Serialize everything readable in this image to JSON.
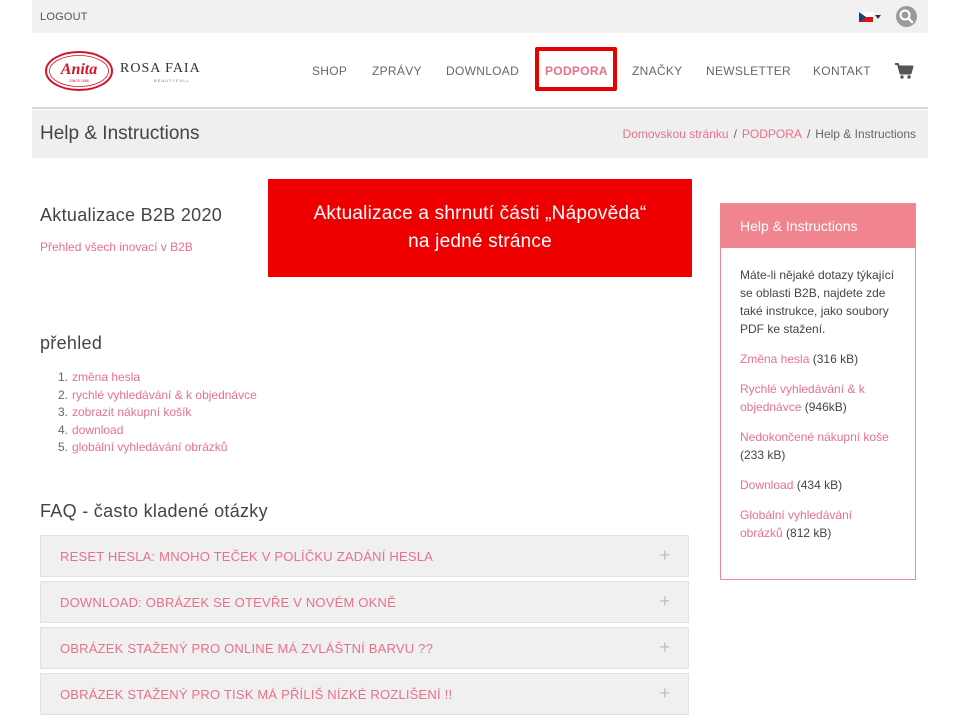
{
  "topbar": {
    "logout_label": "LOGOUT",
    "language": "CZ",
    "search_icon": "search-icon"
  },
  "header": {
    "logo_text": "Anita",
    "logo_since": "SINCE 1886",
    "brand_name": "ROSA FAIA",
    "brand_tagline": "BEAUTYFULL",
    "nav": [
      "SHOP",
      "ZPRÁVY",
      "DOWNLOAD",
      "PODPORA",
      "ZNAČKY",
      "NEWSLETTER",
      "KONTAKT"
    ],
    "active_nav": "PODPORA",
    "cart_icon": "shopping-cart-icon"
  },
  "title_band": {
    "page_title": "Help & Instructions",
    "breadcrumb": [
      "Domovskou stránku",
      "PODPORA",
      "Help & Instructions"
    ],
    "separator": "/"
  },
  "main": {
    "update_heading": "Aktualizace B2B 2020",
    "update_link": "Přehled všech inovací v B2B",
    "overview_heading": "přehled",
    "overview_items": [
      {
        "num": "1.",
        "label": "změna hesla"
      },
      {
        "num": "2.",
        "label": "rychlé vyhledávání & k objednávce"
      },
      {
        "num": "3.",
        "label": "zobrazit nákupní košík"
      },
      {
        "num": "4.",
        "label": "download"
      },
      {
        "num": "5.",
        "label": "globální vyhledávání obrázků"
      }
    ],
    "faq_heading": "FAQ - často kladené otázky",
    "faq_items": [
      "RESET HESLA: MNOHO TEČEK V POLÍČKU ZADÁNÍ HESLA",
      "DOWNLOAD: OBRÁZEK SE OTEVŘE V NOVÉM OKNĚ",
      "OBRÁZEK STAŽENÝ PRO ONLINE MÁ ZVLÁŠTNÍ BARVU ??",
      "OBRÁZEK STAŽENÝ PRO TISK MÁ PŘÍLIŠ NÍZKÉ ROZLIŠENÍ !!"
    ],
    "faq_expand_symbol": "+"
  },
  "callout": {
    "line1": "Aktualizace a shrnutí části „Nápověda“",
    "line2": "na jedné stránce"
  },
  "sidebar": {
    "title": "Help & Instructions",
    "intro": "Máte-li nějaké dotazy týkající se oblasti B2B, najdete zde také instrukce, jako soubory PDF ke stažení.",
    "files": [
      {
        "label": "Změna hesla",
        "size": "(316 kB)"
      },
      {
        "label": "Rychlé vyhledávání & k objednávce",
        "size": "(946kB)"
      },
      {
        "label": "Nedokončené nákupní koše",
        "size": "(233 kB)"
      },
      {
        "label": "Download",
        "size": "(434 kB)"
      },
      {
        "label": "Globální vyhledávání obrázků",
        "size": "(812 kB)"
      }
    ]
  },
  "colors": {
    "accent_pink": "#e8718a",
    "sidebar_header": "#f0848f",
    "callout_red": "#ee0000",
    "highlight_red": "#e60000"
  }
}
